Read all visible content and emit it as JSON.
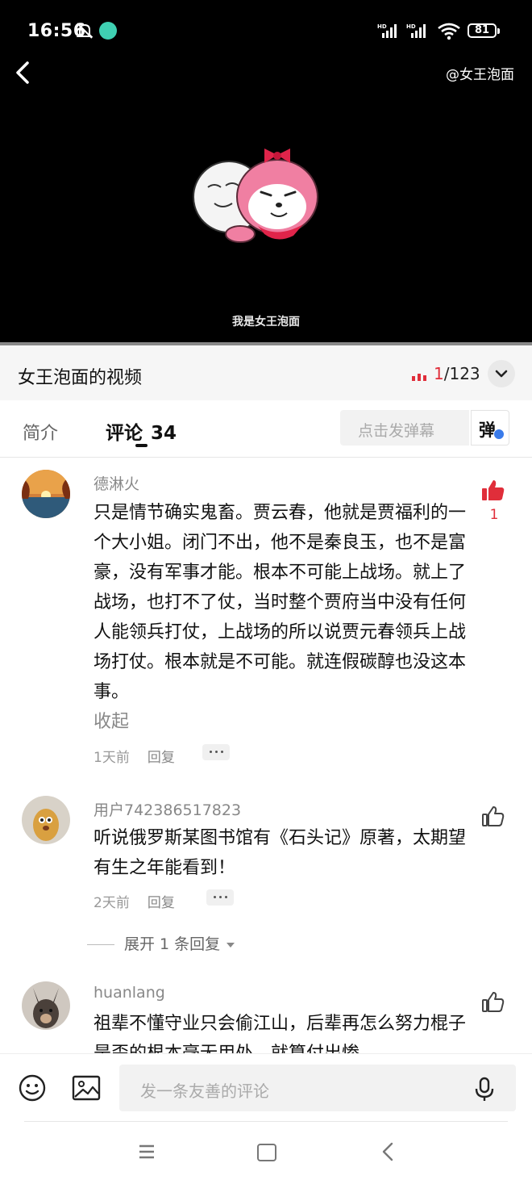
{
  "status_bar": {
    "time": "16:56",
    "battery": "81",
    "icons": [
      "mute-bell-icon",
      "app-notification-icon",
      "hd-signal-icon",
      "hd-signal-icon",
      "wifi-icon",
      "battery-icon"
    ]
  },
  "video": {
    "author_tag": "@女王泡面",
    "subtitle": "我是女王泡面"
  },
  "title_bar": {
    "title": "女王泡面的视频",
    "current": "1",
    "total": "/123"
  },
  "tabs": {
    "intro": "简介",
    "comments": "评论",
    "comments_count": "34",
    "danmu_placeholder": "点击发弹幕",
    "danmu_button": "弹"
  },
  "comments": [
    {
      "user": "德淋火",
      "text": "只是情节确实鬼畜。贾云春，他就是贾福利的一个大小姐。闭门不出，他不是秦良玉，也不是富豪，没有军事才能。根本不可能上战场。就上了战场，也打不了仗，当时整个贾府当中没有任何人能领兵打仗，上战场的所以说贾元春领兵上战场打仗。根本就是不可能。就连假碳醇也没这本事。",
      "collapse": "收起",
      "time": "1天前",
      "reply": "回复",
      "likes": "1",
      "liked": true
    },
    {
      "user": "用户742386517823",
      "text": "听说俄罗斯某图书馆有《石头记》原著，太期望有生之年能看到！",
      "time": "2天前",
      "reply": "回复",
      "expand": "展开 1 条回复"
    },
    {
      "user": "huanlang",
      "text": "祖辈不懂守业只会偷江山，后辈再怎么努力棍子是歪的根本毫无用处，就算付出惨"
    }
  ],
  "input_bar": {
    "placeholder": "发一条友善的评论"
  },
  "colors": {
    "accent_red": "#e02e3a",
    "video_bg": "#000000",
    "muted_text": "#888888"
  }
}
